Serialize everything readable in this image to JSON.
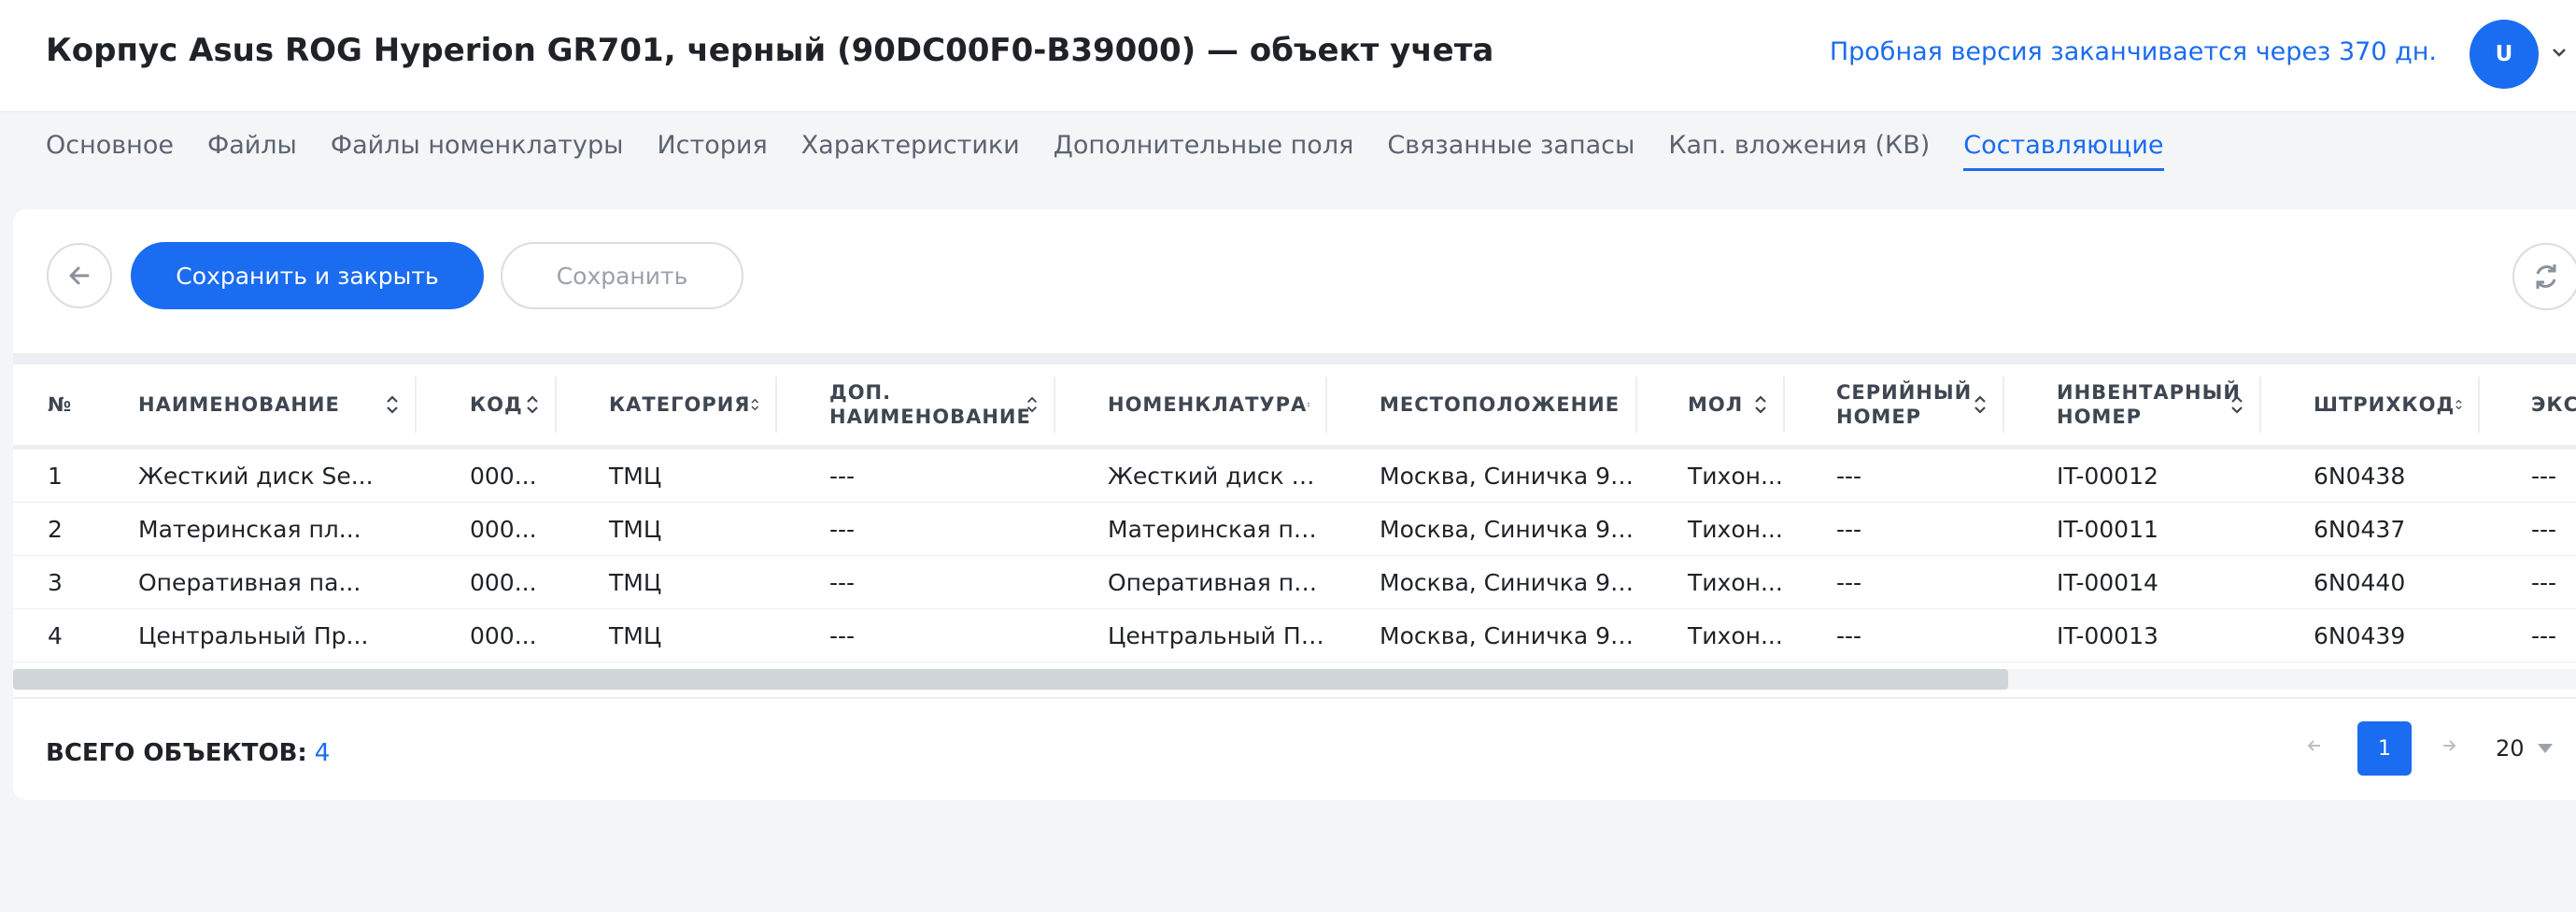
{
  "header": {
    "title": "Корпус Asus ROG Hyperion GR701, черный (90DC00F0-B39000) — объект учета",
    "trial_text": "Пробная версия заканчивается через 370 дн.",
    "avatar_letter": "U"
  },
  "tabs": [
    {
      "label": "Основное"
    },
    {
      "label": "Файлы"
    },
    {
      "label": "Файлы номенклатуры"
    },
    {
      "label": "История"
    },
    {
      "label": "Характеристики"
    },
    {
      "label": "Дополнительные поля"
    },
    {
      "label": "Связанные запасы"
    },
    {
      "label": "Кап. вложения (КВ)"
    },
    {
      "label": "Составляющие",
      "active": true
    }
  ],
  "toolbar": {
    "save_close_label": "Сохранить и закрыть",
    "save_label": "Сохранить"
  },
  "table": {
    "columns": [
      {
        "label": "№",
        "sortable": false
      },
      {
        "label": "НАИМЕНОВАНИЕ",
        "sortable": true
      },
      {
        "label": "КОД",
        "sortable": true
      },
      {
        "label": "КАТЕГОРИЯ",
        "sortable": true
      },
      {
        "label": "ДОП. НАИМЕНОВАНИЕ",
        "sortable": true
      },
      {
        "label": "НОМЕНКЛАТУРА",
        "sortable": true
      },
      {
        "label": "МЕСТОПОЛОЖЕНИЕ",
        "sortable": true
      },
      {
        "label": "МОЛ",
        "sortable": true
      },
      {
        "label": "СЕРИЙНЫЙ НОМЕР",
        "sortable": true
      },
      {
        "label": "ИНВЕНТАРНЫЙ НОМЕР",
        "sortable": true
      },
      {
        "label": "ШТРИХКОД",
        "sortable": true
      },
      {
        "label": "ЭКСПЛУ",
        "sortable": false
      }
    ],
    "rows": [
      [
        "1",
        "Жесткий диск Se...",
        "000...",
        "ТМЦ",
        "---",
        "Жесткий диск Se...",
        "Москва, Синичка 9а...",
        "Тихон...",
        "---",
        "IT-00012",
        "6N0438",
        "---"
      ],
      [
        "2",
        "Материнская пл...",
        "000...",
        "ТМЦ",
        "---",
        "Материнская пл...",
        "Москва, Синичка 9а...",
        "Тихон...",
        "---",
        "IT-00011",
        "6N0437",
        "---"
      ],
      [
        "3",
        "Оперативная па...",
        "000...",
        "ТМЦ",
        "---",
        "Оперативная па...",
        "Москва, Синичка 9а...",
        "Тихон...",
        "---",
        "IT-00014",
        "6N0440",
        "---"
      ],
      [
        "4",
        "Центральный Пр...",
        "000...",
        "ТМЦ",
        "---",
        "Центральный Пр...",
        "Москва, Синичка 9а...",
        "Тихон...",
        "---",
        "IT-00013",
        "6N0439",
        "---"
      ]
    ]
  },
  "footer": {
    "total_label": "ВСЕГО ОБЪЕКТОВ:",
    "total_count": "4",
    "current_page": "1",
    "page_size": "20"
  },
  "colors": {
    "accent": "#1a6cf0",
    "background": "#f4f5f7"
  }
}
